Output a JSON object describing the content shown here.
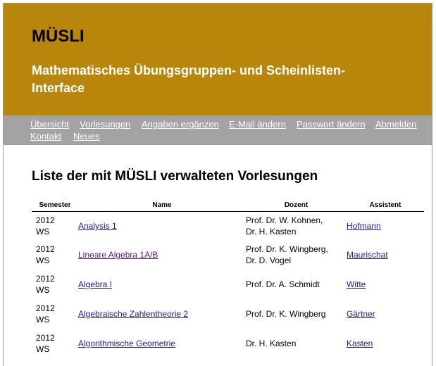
{
  "header": {
    "title": "MÜSLI",
    "subtitle": "Mathematisches Übungsgruppen- und Scheinlisten-Interface"
  },
  "nav": {
    "items": [
      "Übersicht",
      "Vorlesungen",
      "Angaben ergänzen",
      "E-Mail ändern",
      "Passwort ändern",
      "Abmelden",
      "Kontakt",
      "Neues"
    ]
  },
  "main": {
    "heading": "Liste der mit MÜSLI verwalteten Vorlesungen",
    "columns": [
      "Semester",
      "Name",
      "Dozent",
      "Assistent"
    ],
    "rows": [
      {
        "year": "2012",
        "term": "WS",
        "name": "Analysis 1",
        "dozent1": "Prof. Dr. W. Kohnen,",
        "dozent2": "Dr. H. Kasten",
        "assistent": "Hofmann"
      },
      {
        "year": "2012",
        "term": "WS",
        "name": "Lineare Algebra 1A/B",
        "dozent1": "Prof. Dr. K. Wingberg,",
        "dozent2": "Dr. D. Vogel",
        "assistent": "Maurischat"
      },
      {
        "year": "2012",
        "term": "WS",
        "name": "Algebra I",
        "dozent1": "Prof. Dr. A. Schmidt",
        "dozent2": "",
        "assistent": "Witte"
      },
      {
        "year": "2012",
        "term": "WS",
        "name": "Algebraische Zahlentheorie 2",
        "dozent1": "Prof. Dr. K. Wingberg",
        "dozent2": "",
        "assistent": "Gärtner"
      },
      {
        "year": "2012",
        "term": "WS",
        "name": "Algorithmische Geometrie",
        "dozent1": "Dr. H. Kasten",
        "dozent2": "",
        "assistent": "Kasten"
      }
    ]
  },
  "colors": {
    "header_bg": "#b8860b",
    "nav_bg": "#a3a3a3",
    "link": "#1a1aa6",
    "visited_link": "#551a8b"
  }
}
